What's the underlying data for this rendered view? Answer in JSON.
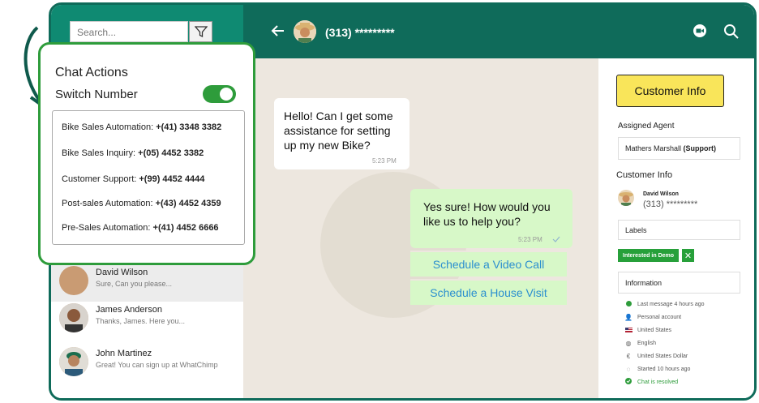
{
  "search": {
    "placeholder": "Search..."
  },
  "header": {
    "phone": "(313) *********"
  },
  "contacts": [
    {
      "name": "David Wilson",
      "msg": "Sure, Can you please..."
    },
    {
      "name": "James Anderson",
      "msg": "Thanks, James. Here you..."
    },
    {
      "name": "John Martinez",
      "msg": "Great! You can sign up at WhatChimp"
    }
  ],
  "chat": {
    "incoming": {
      "text": "Hello! Can I get some assistance for setting up my new Bike?",
      "time": "5:23 PM"
    },
    "outgoing": {
      "text": "Yes sure! How would you like us to help you?",
      "time": "5:23 PM"
    },
    "quick_replies": [
      "Schedule a Video Call",
      "Schedule a House Visit"
    ]
  },
  "right": {
    "customer_info_button": "Customer Info",
    "assigned_agent_label": "Assigned Agent",
    "agent_name": "Mathers Marshall",
    "agent_role": "(Support)",
    "customer_info_label": "Customer Info",
    "customer_name": "David Wilson",
    "customer_phone": "(313) *********",
    "labels_label": "Labels",
    "tag": "Interested in Demo",
    "information_label": "Information",
    "info_rows": [
      {
        "icon": "dot-green",
        "text": "Last message 4 hours ago"
      },
      {
        "icon": "person-icon",
        "text": "Personal account"
      },
      {
        "icon": "flag-us-icon",
        "text": "United States"
      },
      {
        "icon": "globe-icon",
        "text": "English"
      },
      {
        "icon": "currency-icon",
        "text": "United States Dollar"
      },
      {
        "icon": "chat-icon",
        "text": "Started 10 hours ago"
      },
      {
        "icon": "check-circle-icon",
        "text": "Chat is resolved"
      }
    ]
  },
  "popup": {
    "title": "Chat Actions",
    "switch_label": "Switch Number",
    "switch_on": true,
    "numbers": [
      {
        "label": "Bike Sales Automation: ",
        "number": "+(41) 3348 3382"
      },
      {
        "label": "Bike Sales Inquiry: ",
        "number": "+(05) 4452 3382"
      },
      {
        "label": "Customer Support: ",
        "number": "+(99) 4452 4444"
      },
      {
        "label": "Post-sales Automation: ",
        "number": "+(43) 4452 4359"
      },
      {
        "label": "Pre-Sales Automation: ",
        "number": "+(41) 4452 6666"
      }
    ]
  },
  "colors": {
    "header": "#0f6b5a",
    "accent": "#2e9c3b",
    "outgoing": "#d7f8c8",
    "chat_bg": "#ede7df",
    "button_yellow": "#f9e55a"
  }
}
